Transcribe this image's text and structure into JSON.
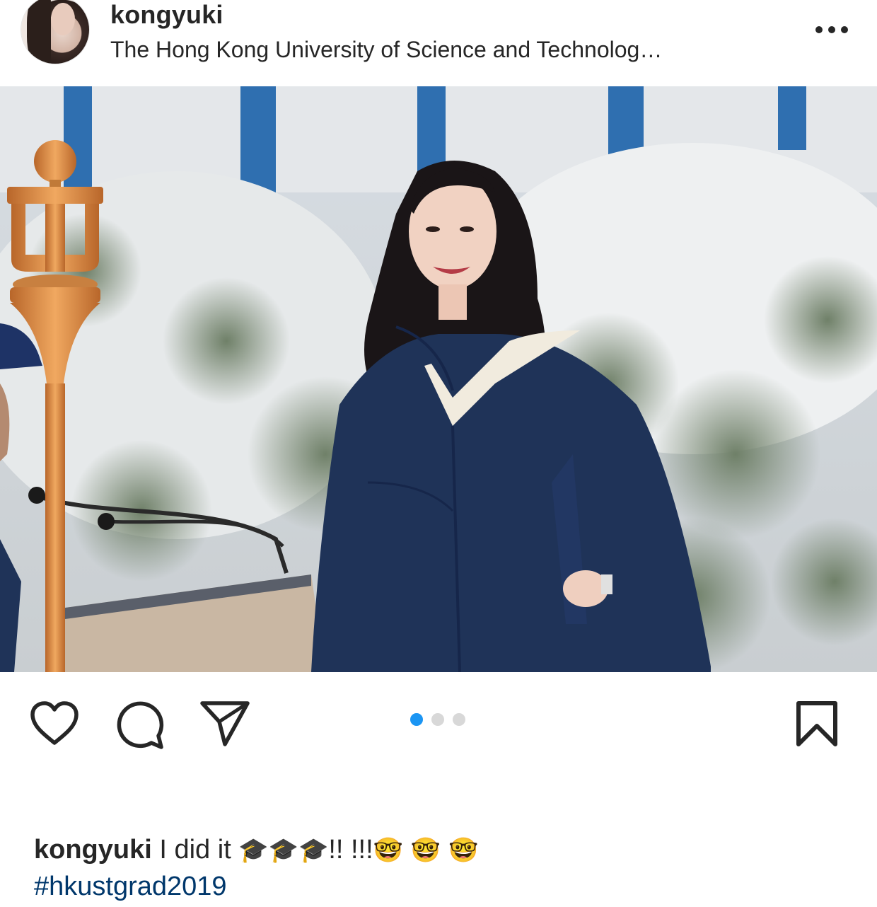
{
  "post": {
    "username": "kongyuki",
    "location": "The Hong Kong University of Science and Technolog…",
    "more_icon": "more-horizontal-icon"
  },
  "photo": {
    "carousel": {
      "count": 3,
      "active_index": 0
    },
    "colors": {
      "active_dot": "#1b95f3",
      "inactive_dot": "#d8d8d8",
      "gown": "#1f3358",
      "hood_trim": "#f1ebde",
      "mace": "#d98a3c"
    }
  },
  "actions": {
    "like_icon": "heart-icon",
    "comment_icon": "comment-icon",
    "share_icon": "send-icon",
    "save_icon": "bookmark-icon"
  },
  "caption": {
    "username": "kongyuki",
    "text": " I did it ",
    "emoji_caps": "🎓🎓🎓",
    "exclaim": "!! !!!",
    "emoji_faces": "🤓 🤓 🤓",
    "hashtag": "#hkustgrad2019",
    "link_color": "#00376b"
  }
}
